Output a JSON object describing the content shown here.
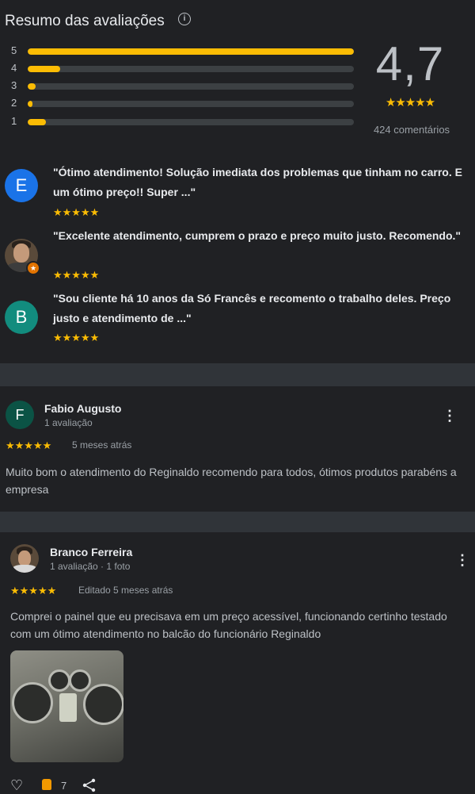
{
  "summary": {
    "title": "Resumo das avaliações",
    "info_icon": "info-icon",
    "average": "4,7",
    "average_stars": "★★★★★",
    "count_label": "424 comentários",
    "bars": [
      {
        "label": "5",
        "fraction": 1.0
      },
      {
        "label": "4",
        "fraction": 0.1
      },
      {
        "label": "3",
        "fraction": 0.025
      },
      {
        "label": "2",
        "fraction": 0.015
      },
      {
        "label": "1",
        "fraction": 0.055
      }
    ]
  },
  "snippets": [
    {
      "avatar_letter": "E",
      "avatar_color": "#1a73e8",
      "text": "\"Ótimo atendimento! Solução imediata dos problemas que tinham no carro. E um ótimo preço!! Super ...\"",
      "stars": "★★★★★"
    },
    {
      "avatar_letter": "",
      "avatar_color": "#5a4a3a",
      "text": "\"Excelente atendimento, cumprem o prazo e preço muito justo. Recomendo.\"",
      "stars": "★★★★★"
    },
    {
      "avatar_letter": "B",
      "avatar_color": "#128c7e",
      "text": "\"Sou cliente há 10 anos da Só Francês e recomento o trabalho deles. Preço justo e atendimento de ...\"",
      "stars": "★★★★★"
    }
  ],
  "reviews": [
    {
      "name": "Fabio Augusto",
      "meta": "1 avaliação",
      "avatar_letter": "F",
      "avatar_color": "#0b5345",
      "stars": "★★★★★",
      "when": "5 meses atrás",
      "text": "Muito bom o atendimento do Reginaldo recomendo para todos, ótimos produtos parabéns a empresa"
    },
    {
      "name": "Branco Ferreira",
      "meta": "1 avaliação · 1 foto",
      "stars": "★★★★★",
      "when": "Editado 5 meses atrás",
      "text": "Comprei o painel que eu precisava em um preço acessível, funcionando certinho testado com um ótimo atendimento no balcão do funcionário Reginaldo",
      "likes": "7"
    }
  ],
  "icons": {
    "more": "⋮",
    "heart": "♡",
    "share": "share-icon"
  },
  "colors": {
    "star": "#fbbc04",
    "background": "#202124",
    "separator": "#303439"
  }
}
